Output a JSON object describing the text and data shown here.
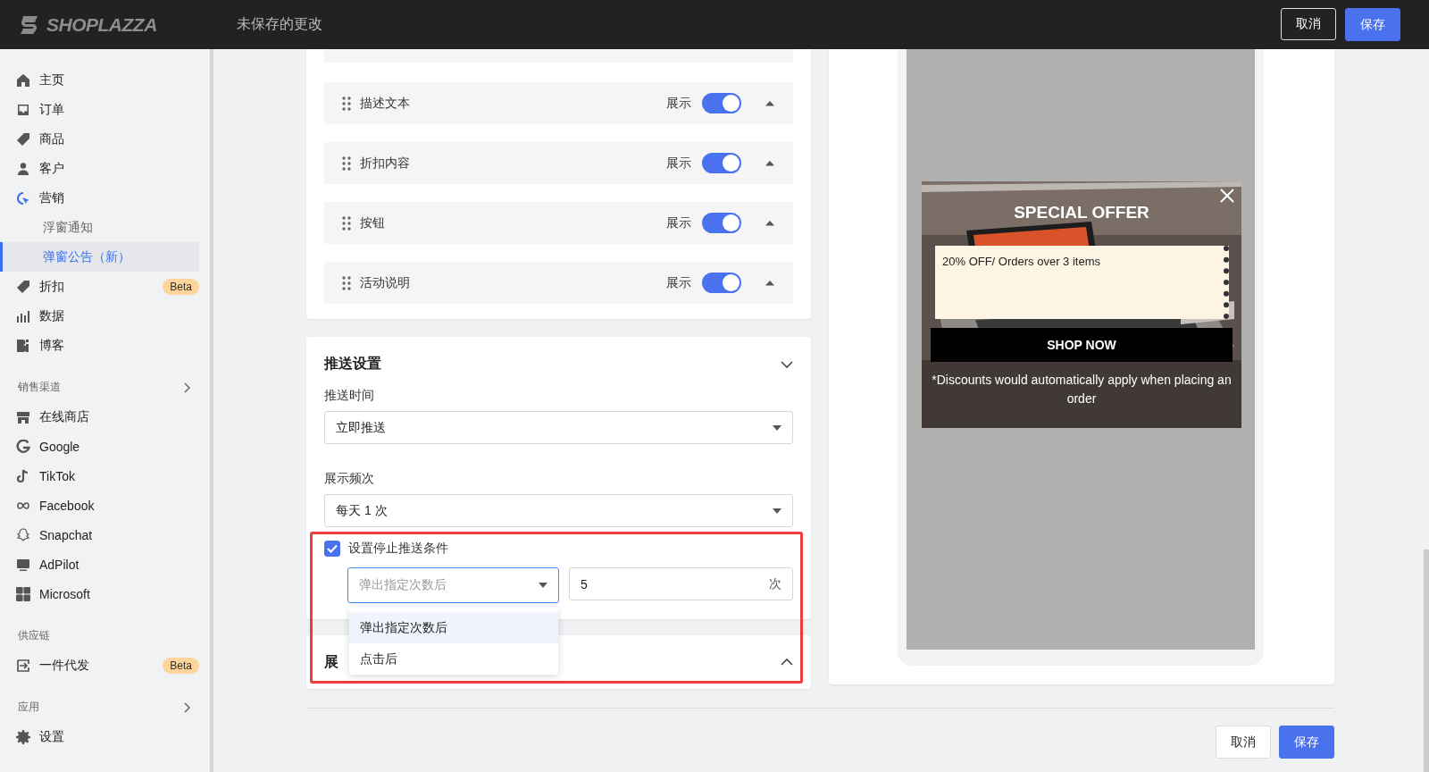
{
  "topbar": {
    "logo": "SHOPLAZZA",
    "title": "未保存的更改",
    "buttons": [
      {
        "label": "取消",
        "kind": "secondary"
      },
      {
        "label": "保存",
        "kind": "primary"
      }
    ]
  },
  "sidebar": {
    "items": [
      {
        "kind": "nav",
        "label": "主页",
        "selected": false
      },
      {
        "kind": "nav",
        "label": "订单",
        "selected": false
      },
      {
        "kind": "nav",
        "label": "商品",
        "selected": false
      },
      {
        "kind": "nav",
        "label": "客户",
        "selected": false
      },
      {
        "kind": "nav",
        "label": "营销",
        "selected": true
      },
      {
        "kind": "sub",
        "label": "浮窗通知",
        "selected": false
      },
      {
        "kind": "sub",
        "label": "弹窗公告（新）",
        "selected": true
      },
      {
        "kind": "nav",
        "label": "折扣",
        "selected": false,
        "badge": "Beta"
      },
      {
        "kind": "nav",
        "label": "数据",
        "selected": false
      },
      {
        "kind": "nav",
        "label": "博客",
        "selected": false
      },
      {
        "kind": "section",
        "label": "销售渠道",
        "expandable": true
      },
      {
        "kind": "nav",
        "label": "在线商店",
        "selected": false
      },
      {
        "kind": "nav",
        "label": "Google",
        "selected": false
      },
      {
        "kind": "nav",
        "label": "TikTok",
        "selected": false
      },
      {
        "kind": "nav",
        "label": "Facebook",
        "selected": false
      },
      {
        "kind": "nav",
        "label": "Snapchat",
        "selected": false
      },
      {
        "kind": "nav",
        "label": "AdPilot",
        "selected": false
      },
      {
        "kind": "nav",
        "label": "Microsoft",
        "selected": false
      },
      {
        "kind": "section",
        "label": "供应链",
        "expandable": false
      },
      {
        "kind": "nav",
        "label": "一件代发",
        "selected": false,
        "badge": "Beta"
      },
      {
        "kind": "section",
        "label": "应用",
        "expandable": true
      },
      {
        "kind": "nav",
        "label": "设置",
        "selected": false
      }
    ]
  },
  "content_rows": [
    {
      "label": "描述文本",
      "toggle_label": "展示",
      "on": true
    },
    {
      "label": "折扣内容",
      "toggle_label": "展示",
      "on": true
    },
    {
      "label": "按钮",
      "toggle_label": "展示",
      "on": true
    },
    {
      "label": "活动说明",
      "toggle_label": "展示",
      "on": true
    }
  ],
  "push_settings": {
    "title": "推送设置",
    "fields": [
      {
        "label": "推送时间",
        "value": "立即推送"
      },
      {
        "label": "展示频次",
        "value": "每天 1 次"
      }
    ],
    "stop_condition": {
      "checked": true,
      "label": "设置停止推送条件",
      "select": {
        "placeholder": "弹出指定次数后"
      },
      "count": {
        "value": "5",
        "unit": "次"
      },
      "options": [
        {
          "label": "弹出指定次数后",
          "selected": true
        },
        {
          "label": "点击后",
          "selected": false
        }
      ]
    }
  },
  "display_section": {
    "title": "展"
  },
  "footer_buttons": [
    {
      "label": "取消",
      "kind": "secondary"
    },
    {
      "label": "保存",
      "kind": "primary"
    }
  ],
  "preview": {
    "title": "SPECIAL OFFER",
    "offer": "20% OFF/ Orders over 3 items",
    "button": "SHOP NOW",
    "note": "*Discounts would automatically apply when placing an order"
  }
}
